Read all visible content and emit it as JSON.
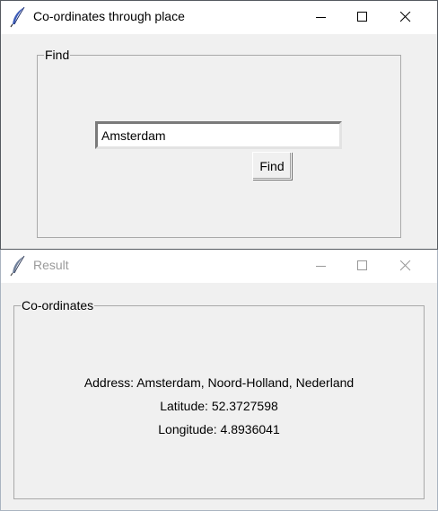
{
  "find_window": {
    "title": "Co-ordinates through place",
    "group_label": "Find",
    "search_value": "Amsterdam",
    "find_button_label": "Find",
    "icon": "tk-feather-icon"
  },
  "result_window": {
    "title": "Result",
    "group_label": "Co-ordinates",
    "address_label": "Address:",
    "address_value": "Amsterdam, Noord-Holland, Nederland",
    "latitude_label": "Latitude:",
    "latitude_value": "52.3727598",
    "longitude_label": "Longitude:",
    "longitude_value": "4.8936041",
    "icon": "tk-feather-icon"
  },
  "titlebar_controls": [
    "minimize-icon",
    "maximize-icon",
    "close-icon"
  ],
  "colors": {
    "window_bg": "#f0f0f0",
    "titlebar_bg": "#ffffff",
    "inactive_title": "#9a9a9a"
  }
}
